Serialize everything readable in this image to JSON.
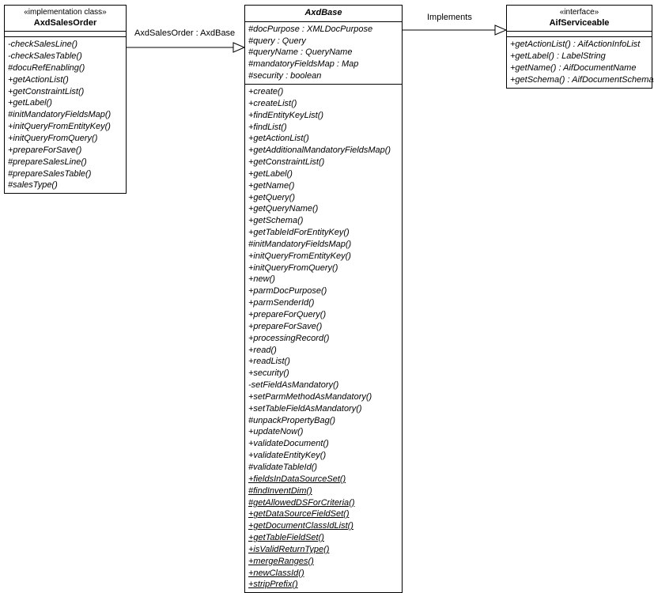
{
  "classes": {
    "axdSalesOrder": {
      "stereotype": "«implementation class»",
      "name": "AxdSalesOrder",
      "ops": [
        "-checkSalesLine()",
        "-checkSalesTable()",
        "#docuRefEnabling()",
        "+getActionList()",
        "+getConstraintList()",
        "+getLabel()",
        "#initMandatoryFieldsMap()",
        "+initQueryFromEntityKey()",
        "+initQueryFromQuery()",
        "+prepareForSave()",
        "#prepareSalesLine()",
        "#prepareSalesTable()",
        "#salesType()"
      ]
    },
    "axdBase": {
      "name": "AxdBase",
      "attrs": [
        "#docPurpose : XMLDocPurpose",
        "#query : Query",
        "#queryName : QueryName",
        "#mandatoryFieldsMap : Map",
        "#security : boolean"
      ],
      "ops": [
        {
          "t": "+create()"
        },
        {
          "t": "+createList()"
        },
        {
          "t": "+findEntityKeyList()"
        },
        {
          "t": "+findList()"
        },
        {
          "t": "+getActionList()"
        },
        {
          "t": "+getAdditionalMandatoryFieldsMap()"
        },
        {
          "t": "+getConstraintList()"
        },
        {
          "t": "+getLabel()"
        },
        {
          "t": "+getName()"
        },
        {
          "t": "+getQuery()"
        },
        {
          "t": "+getQueryName()"
        },
        {
          "t": "+getSchema()"
        },
        {
          "t": "+getTableIdForEntityKey()"
        },
        {
          "t": "#initMandatoryFieldsMap()"
        },
        {
          "t": "+initQueryFromEntityKey()"
        },
        {
          "t": "+initQueryFromQuery()"
        },
        {
          "t": "+new()"
        },
        {
          "t": "+parmDocPurpose()"
        },
        {
          "t": "+parmSenderId()"
        },
        {
          "t": "+prepareForQuery()"
        },
        {
          "t": "+prepareForSave()"
        },
        {
          "t": "+processingRecord()"
        },
        {
          "t": "+read()"
        },
        {
          "t": "+readList()"
        },
        {
          "t": "+security()"
        },
        {
          "t": "-setFieldAsMandatory()"
        },
        {
          "t": "+setParmMethodAsMandatory()"
        },
        {
          "t": "+setTableFieldAsMandatory()"
        },
        {
          "t": "#unpackPropertyBag()"
        },
        {
          "t": "+updateNow()"
        },
        {
          "t": "+validateDocument()"
        },
        {
          "t": "+validateEntityKey()"
        },
        {
          "t": "#validateTableId()"
        },
        {
          "t": "+fieldsInDataSourceSet()",
          "u": true
        },
        {
          "t": "#findInventDim()",
          "u": true
        },
        {
          "t": "#getAllowedDSForCriteria()",
          "u": true
        },
        {
          "t": "+getDataSourceFieldSet()",
          "u": true
        },
        {
          "t": "+getDocumentClassIdList()",
          "u": true
        },
        {
          "t": "+getTableFieldSet()",
          "u": true
        },
        {
          "t": "+isValidReturnType()",
          "u": true
        },
        {
          "t": "+mergeRanges()",
          "u": true
        },
        {
          "t": "+newClassId()",
          "u": true
        },
        {
          "t": "+stripPrefix()",
          "u": true
        }
      ]
    },
    "aifServiceable": {
      "stereotype": "«interface»",
      "name": "AifServiceable",
      "ops": [
        "+getActionList() : AifActionInfoList",
        "+getLabel() : LabelString",
        "+getName() : AifDocumentName",
        "+getSchema() : AifDocumentSchemaXml"
      ]
    }
  },
  "relations": {
    "realizationLabel": "AxdSalesOrder : AxdBase",
    "implementsLabel": "Implements"
  }
}
